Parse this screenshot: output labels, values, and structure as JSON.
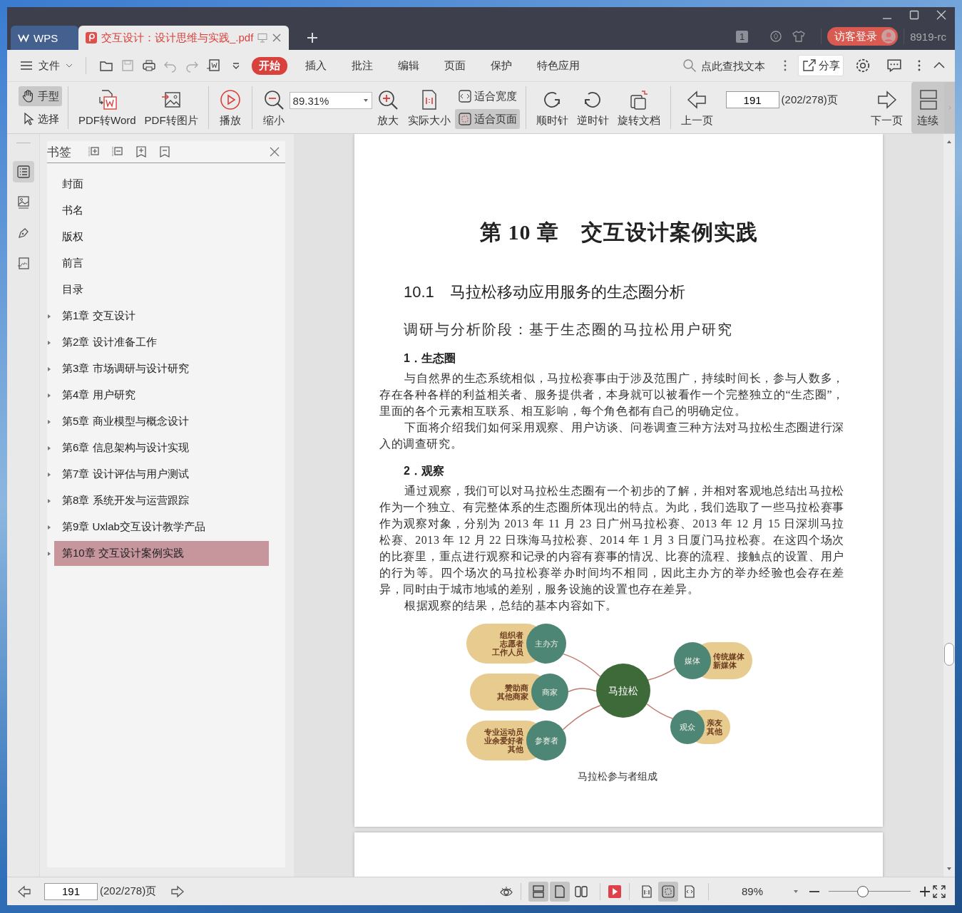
{
  "tabs": [
    {
      "label": "WPS",
      "kind": "home",
      "selected": false
    },
    {
      "label": "交互设计：设计思维与实践_.pdf",
      "kind": "pdf",
      "selected": true
    }
  ],
  "title_bar": {
    "window_count": "1",
    "login_button": "访客登录",
    "user_label": "8919-rc"
  },
  "menu_bar": {
    "file_menu": "文件",
    "tabs": [
      {
        "label": "开始",
        "selected": true
      },
      {
        "label": "插入",
        "selected": false
      },
      {
        "label": "批注",
        "selected": false
      },
      {
        "label": "编辑",
        "selected": false
      },
      {
        "label": "页面",
        "selected": false
      },
      {
        "label": "保护",
        "selected": false
      },
      {
        "label": "特色应用",
        "selected": false
      }
    ],
    "search_placeholder": "点此查找文本",
    "share_button": "分享"
  },
  "toolbar": {
    "pointer_tools": [
      {
        "kind": "hand",
        "label": "手型",
        "selected": true
      },
      {
        "kind": "select",
        "label": "选择",
        "selected": false
      }
    ],
    "convert_tools": [
      {
        "kind": "pdf-to-word",
        "label": "PDF转Word"
      },
      {
        "kind": "pdf-to-image",
        "label": "PDF转图片"
      }
    ],
    "play_button": "播放",
    "zoom_out": "缩小",
    "zoom_value": "89.31%",
    "zoom_in": "放大",
    "actual_size": "实际大小",
    "fit_modes": [
      {
        "kind": "width",
        "label": "适合宽度",
        "selected": false
      },
      {
        "kind": "page",
        "label": "适合页面",
        "selected": true
      }
    ],
    "rotate_tools": [
      {
        "kind": "clockwise",
        "label": "顺时针"
      },
      {
        "kind": "counterclockwise",
        "label": "逆时针"
      },
      {
        "kind": "document",
        "label": "旋转文档"
      }
    ],
    "prev_page": "上一页",
    "page_number": "191",
    "page_total": "(202/278)页",
    "next_page": "下一页",
    "continuous_mode": {
      "label": "连续",
      "selected": true
    }
  },
  "side_rail": [
    {
      "kind": "bookmarks",
      "selected": true
    },
    {
      "kind": "thumbnails",
      "selected": false
    },
    {
      "kind": "annotations",
      "selected": false
    },
    {
      "kind": "signatures",
      "selected": false
    }
  ],
  "bookmarks": {
    "title": "书签",
    "items": [
      {
        "label": "封面",
        "expandable": false,
        "selected": false
      },
      {
        "label": "书名",
        "expandable": false,
        "selected": false
      },
      {
        "label": "版权",
        "expandable": false,
        "selected": false
      },
      {
        "label": "前言",
        "expandable": false,
        "selected": false
      },
      {
        "label": "目录",
        "expandable": false,
        "selected": false
      },
      {
        "label": "第1章  交互设计",
        "expandable": true,
        "selected": false
      },
      {
        "label": "第2章  设计准备工作",
        "expandable": true,
        "selected": false
      },
      {
        "label": "第3章  市场调研与设计研究",
        "expandable": true,
        "selected": false
      },
      {
        "label": "第4章  用户研究",
        "expandable": true,
        "selected": false
      },
      {
        "label": "第5章  商业模型与概念设计",
        "expandable": true,
        "selected": false
      },
      {
        "label": "第6章  信息架构与设计实现",
        "expandable": true,
        "selected": false
      },
      {
        "label": "第7章  设计评估与用户测试",
        "expandable": true,
        "selected": false
      },
      {
        "label": "第8章  系统开发与运营跟踪",
        "expandable": true,
        "selected": false
      },
      {
        "label": "第9章  Uxlab交互设计教学产品",
        "expandable": true,
        "selected": false
      },
      {
        "label": "第10章  交互设计案例实践",
        "expandable": true,
        "selected": true
      }
    ]
  },
  "document": {
    "chapter_title": "第 10 章　交互设计案例实践",
    "section_title": "10.1　马拉松移动应用服务的生态圈分析",
    "subtitle": "调研与分析阶段：基于生态圈的马拉松用户研究",
    "blocks": [
      {
        "kind": "heading",
        "text": "1．生态圈"
      },
      {
        "kind": "paragraph",
        "text": "与自然界的生态系统相似，马拉松赛事由于涉及范围广，持续时间长，参与人数多，存在各种各样的利益相关者、服务提供者，本身就可以被看作一个完整独立的“生态圈”，里面的各个元素相互联系、相互影响，每个角色都有自己的明确定位。"
      },
      {
        "kind": "paragraph",
        "text": "下面将介绍我们如何采用观察、用户访谈、问卷调查三种方法对马拉松生态圈进行深入的调查研究。"
      },
      {
        "kind": "heading",
        "text": "2．观察"
      },
      {
        "kind": "paragraph",
        "text": "通过观察，我们可以对马拉松生态圈有一个初步的了解，并相对客观地总结出马拉松作为一个独立、有完整体系的生态圈所体现出的特点。为此，我们选取了一些马拉松赛事作为观察对象，分别为 2013 年 11 月 23 日广州马拉松赛、2013 年 12 月 15 日深圳马拉松赛、2013 年 12 月 22 日珠海马拉松赛、2014 年 1 月 3 日厦门马拉松赛。在这四个场次的比赛里，重点进行观察和记录的内容有赛事的情况、比赛的流程、接触点的设置、用户的行为等。四个场次的马拉松赛举办时间均不相同，因此主办方的举办经验也会存在差异，同时由于城市地域的差别，服务设施的设置也存在差异。"
      },
      {
        "kind": "paragraph",
        "text": "根据观察的结果，总结的基本内容如下。"
      }
    ],
    "figure": {
      "center": "马拉松",
      "left_nodes": [
        {
          "label": "主办方",
          "details": [
            "组织者",
            "志愿者",
            "工作人员"
          ]
        },
        {
          "label": "商家",
          "details": [
            "赞助商",
            "其他商家"
          ]
        },
        {
          "label": "参赛者",
          "details": [
            "专业运动员",
            "业余爱好者",
            "其他"
          ]
        }
      ],
      "right_nodes": [
        {
          "label": "媒体",
          "details": [
            "传统媒体",
            "新媒体"
          ]
        },
        {
          "label": "观众",
          "details": [
            "亲友",
            "其他"
          ]
        }
      ],
      "caption": "马拉松参与者组成"
    }
  },
  "status_bar": {
    "page_number": "191",
    "page_total": "(202/278)页",
    "view_modes": [
      {
        "kind": "continuous",
        "selected": true
      },
      {
        "kind": "single",
        "selected": true
      },
      {
        "kind": "double",
        "selected": false
      }
    ],
    "fit_modes": [
      {
        "kind": "actual",
        "selected": false
      },
      {
        "kind": "page",
        "selected": true
      },
      {
        "kind": "width",
        "selected": false
      }
    ],
    "zoom": "89%",
    "zoom_slider": {
      "level": 0.42
    }
  }
}
